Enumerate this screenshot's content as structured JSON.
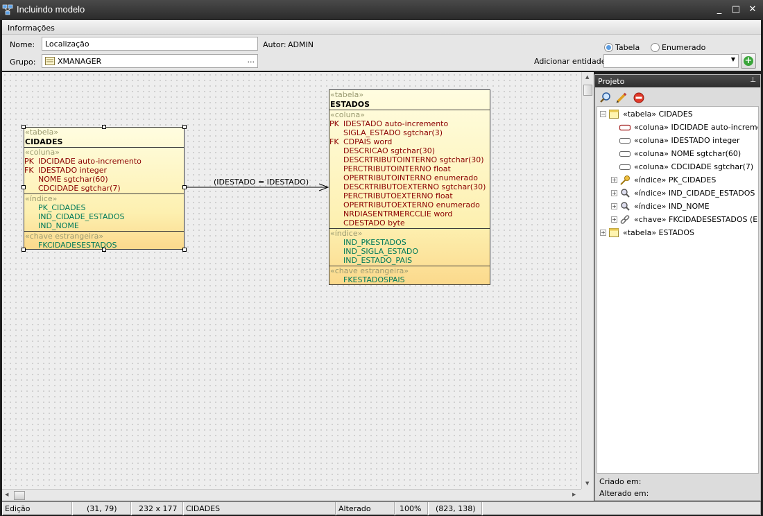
{
  "window": {
    "title": "Incluindo modelo"
  },
  "form": {
    "section_label": "Informações",
    "name_label": "Nome:",
    "name_value": "Localização",
    "author_label": "Autor:",
    "author_value": "ADMIN",
    "group_label": "Grupo:",
    "group_value": "XMANAGER",
    "group_button": "...",
    "radio_tabela": "Tabela",
    "radio_enumerado": "Enumerado",
    "add_entity_label": "Adicionar entidade:"
  },
  "diagram": {
    "relation_label": "(IDESTADO = IDESTADO)",
    "cidades": {
      "stereo_table": "«tabela»",
      "name": "CIDADES",
      "stereo_columns": "«coluna»",
      "columns": [
        {
          "key": "PK",
          "text": "IDCIDADE auto-incremento"
        },
        {
          "key": "FK",
          "text": "IDESTADO integer"
        },
        {
          "key": "",
          "text": "NOME sgtchar(60)"
        },
        {
          "key": "",
          "text": "CDCIDADE sgtchar(7)"
        }
      ],
      "stereo_indexes": "«índice»",
      "indexes": [
        "PK_CIDADES",
        "IND_CIDADE_ESTADOS",
        "IND_NOME"
      ],
      "stereo_fks": "«chave estrangeira»",
      "fks": [
        "FKCIDADESESTADOS"
      ]
    },
    "estados": {
      "stereo_table": "«tabela»",
      "name": "ESTADOS",
      "stereo_columns": "«coluna»",
      "columns": [
        {
          "key": "PK",
          "text": "IDESTADO auto-incremento"
        },
        {
          "key": "",
          "text": "SIGLA_ESTADO sgtchar(3)"
        },
        {
          "key": "FK",
          "text": "CDPAIS word"
        },
        {
          "key": "",
          "text": "DESCRICAO sgtchar(30)"
        },
        {
          "key": "",
          "text": "DESCRTRIBUTOINTERNO sgtchar(30)"
        },
        {
          "key": "",
          "text": "PERCTRIBUTOINTERNO float"
        },
        {
          "key": "",
          "text": "OPERTRIBUTOINTERNO enumerado"
        },
        {
          "key": "",
          "text": "DESCRTRIBUTOEXTERNO sgtchar(30)"
        },
        {
          "key": "",
          "text": "PERCTRIBUTOEXTERNO float"
        },
        {
          "key": "",
          "text": "OPERTRIBUTOEXTERNO enumerado"
        },
        {
          "key": "",
          "text": "NRDIASENTRMERCCLIE word"
        },
        {
          "key": "",
          "text": "CDESTADO byte"
        }
      ],
      "stereo_indexes": "«índice»",
      "indexes": [
        "IND_PKESTADOS",
        "IND_SIGLA_ESTADO",
        "IND_ESTADO_PAIS"
      ],
      "stereo_fks": "«chave estrangeira»",
      "fks": [
        "FKESTADOSPAIS"
      ]
    }
  },
  "panel": {
    "title": "Projeto",
    "pin": "📌",
    "tree": [
      {
        "text": "«tabela»  CIDADES",
        "level": 0,
        "expander": "−",
        "icon": "table-icon"
      },
      {
        "text": "«coluna»  IDCIDADE auto-incremento",
        "level": 1,
        "expander": "",
        "icon": "column-pk-icon"
      },
      {
        "text": "«coluna»  IDESTADO integer",
        "level": 1,
        "expander": "",
        "icon": "column-icon"
      },
      {
        "text": "«coluna»  NOME sgtchar(60)",
        "level": 1,
        "expander": "",
        "icon": "column-icon"
      },
      {
        "text": "«coluna»  CDCIDADE sgtchar(7)",
        "level": 1,
        "expander": "",
        "icon": "column-icon"
      },
      {
        "text": "«índice»  PK_CIDADES",
        "level": 1,
        "expander": "+",
        "icon": "key-icon"
      },
      {
        "text": "«índice»  IND_CIDADE_ESTADOS",
        "level": 1,
        "expander": "+",
        "icon": "index-icon"
      },
      {
        "text": "«índice»  IND_NOME",
        "level": 1,
        "expander": "+",
        "icon": "index-icon"
      },
      {
        "text": "«chave»  FKCIDADESESTADOS (ESTA",
        "level": 1,
        "expander": "+",
        "icon": "link-icon"
      },
      {
        "text": "«tabela»  ESTADOS",
        "level": 0,
        "expander": "+",
        "icon": "table-icon"
      }
    ],
    "created_label": "Criado em:",
    "altered_label": "Alterado em:"
  },
  "status": {
    "mode": "Edição",
    "position": "(31, 79)",
    "size": "232 x 177",
    "selected": "CIDADES",
    "state": "Alterado",
    "zoom": "100%",
    "cursor": "(823, 138)"
  }
}
